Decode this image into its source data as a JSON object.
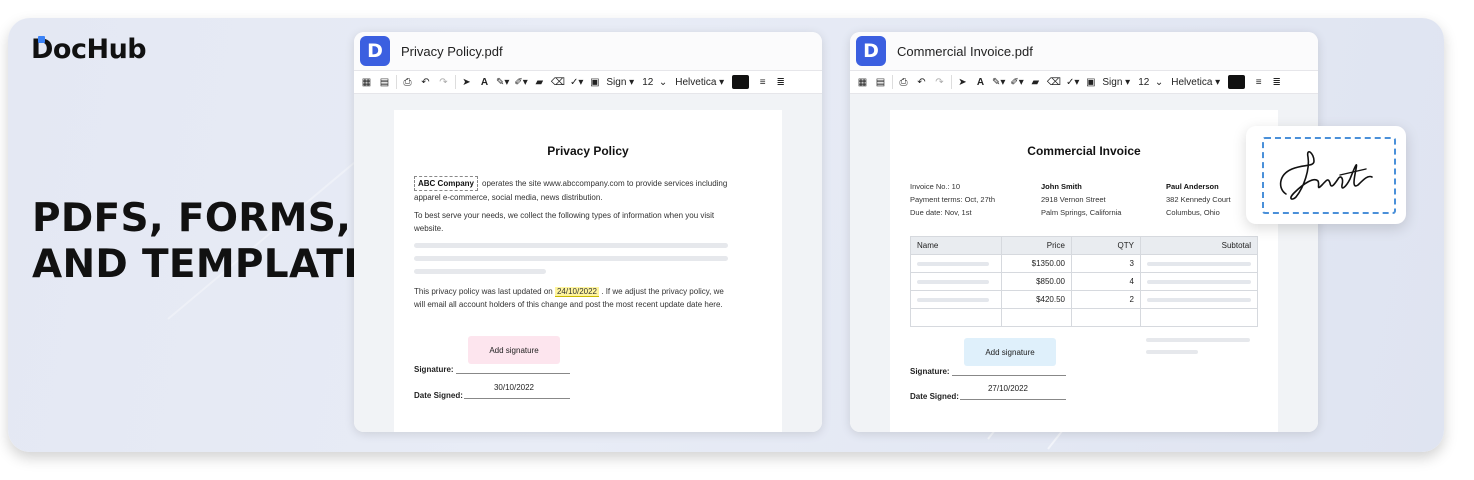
{
  "brand": {
    "logo_text": "DocHub",
    "accent": "#3b82f6"
  },
  "headline": {
    "line1": "PDFS, FORMS,",
    "line2": "AND TEMPLATES"
  },
  "toolbar": {
    "sign_label": "Sign",
    "font_size": "12",
    "font_name": "Helvetica",
    "color_value": "#111111"
  },
  "privacy_window": {
    "filename": "Privacy Policy.pdf",
    "doc_title": "Privacy Policy",
    "company_tag": "ABC Company",
    "para1": "operates the site www.abccompany.com to provide services including apparel e-commerce, social media, news distribution.",
    "para2": "To best serve your needs, we collect the following types of information when you visit website.",
    "para3_before": "This privacy policy was last updated on",
    "para3_date": "24/10/2022",
    "para3_after": ". If we adjust the privacy policy, we will email all account holders of this change and post the most recent update date here.",
    "add_signature": "Add signature",
    "signature_label": "Signature:",
    "date_signed_label": "Date Signed:",
    "date_signed_value": "30/10/2022"
  },
  "invoice_window": {
    "filename": "Commercial Invoice.pdf",
    "doc_title": "Commercial Invoice",
    "invoice_no": "Invoice No.: 10",
    "payment_terms": "Payment terms: Oct, 27th",
    "due_date": "Due date: Nov, 1st",
    "from_name": "John Smith",
    "from_addr1": "2918 Vernon Street",
    "from_addr2": "Palm Springs, California",
    "to_name": "Paul Anderson",
    "to_addr1": "382 Kennedy Court",
    "to_addr2": "Columbus, Ohio",
    "table": {
      "headers": [
        "Name",
        "Price",
        "QTY",
        "Subtotal"
      ],
      "rows": [
        {
          "price": "$1350.00",
          "qty": "3"
        },
        {
          "price": "$850.00",
          "qty": "4"
        },
        {
          "price": "$420.50",
          "qty": "2"
        }
      ]
    },
    "add_signature": "Add signature",
    "signature_label": "Signature:",
    "date_signed_label": "Date Signed:",
    "date_signed_value": "27/10/2022"
  }
}
